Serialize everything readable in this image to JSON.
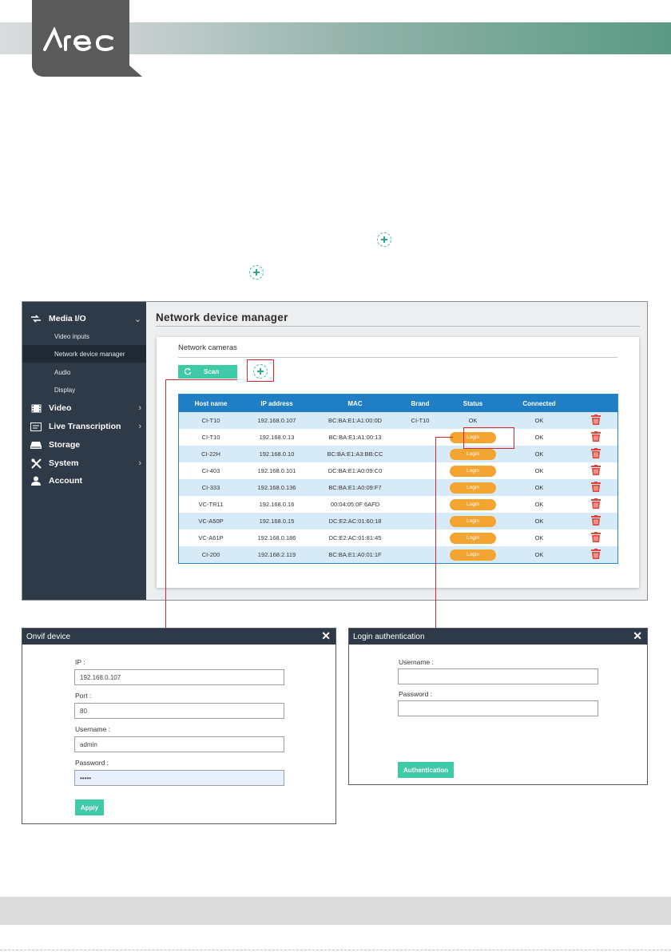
{
  "brand": {
    "logo_text": "Arec"
  },
  "sidebar": {
    "items": [
      {
        "label": "Media I/O",
        "icon": "media-io-icon",
        "chevron": "down"
      },
      {
        "label": "Video",
        "icon": "film-icon",
        "chevron": "right"
      },
      {
        "label": "Live Transcription",
        "icon": "caption-icon",
        "chevron": "right"
      },
      {
        "label": "Storage",
        "icon": "storage-icon",
        "chevron": ""
      },
      {
        "label": "System",
        "icon": "tools-icon",
        "chevron": "right"
      },
      {
        "label": "Account",
        "icon": "user-icon",
        "chevron": ""
      }
    ],
    "subitems": [
      {
        "label": "Video inputs",
        "active": false
      },
      {
        "label": "Network device manager",
        "active": true
      },
      {
        "label": "Audio",
        "active": false
      },
      {
        "label": "Display",
        "active": false
      }
    ]
  },
  "page": {
    "title": "Network device manager",
    "section_title": "Network cameras",
    "scan_label": "Scan"
  },
  "table": {
    "headers": [
      "Host name",
      "IP address",
      "MAC",
      "Brand",
      "Status",
      "Connected",
      ""
    ],
    "rows": [
      {
        "host": "CI-T10",
        "ip": "192.168.0.107",
        "mac": "BC:BA:E1:A1:00:0D",
        "brand": "CI-T10",
        "status": "OK",
        "connected": "OK"
      },
      {
        "host": "CI-T10",
        "ip": "192.168.0.13",
        "mac": "BC:BA:E1:A1:00:13",
        "brand": "",
        "status": "Login",
        "connected": "OK"
      },
      {
        "host": "CI-22H",
        "ip": "192.168.0.10",
        "mac": "BC:BA:E1:A3:BB:CC",
        "brand": "",
        "status": "Login",
        "connected": "OK"
      },
      {
        "host": "CI-403",
        "ip": "192.168.0.101",
        "mac": "DC:BA:E1:A0:09:C0",
        "brand": "",
        "status": "Login",
        "connected": "OK"
      },
      {
        "host": "CI-333",
        "ip": "192.168.0.136",
        "mac": "BC:BA:E1:A0:09:F7",
        "brand": "",
        "status": "Login",
        "connected": "OK"
      },
      {
        "host": "VC-TR11",
        "ip": "192.168.0.16",
        "mac": "00:04:05:0F:6AFD",
        "brand": "",
        "status": "Login",
        "connected": "OK"
      },
      {
        "host": "VC-A50P",
        "ip": "192.168.0.15",
        "mac": "DC:E2:AC:01:60:18",
        "brand": "",
        "status": "Login",
        "connected": "OK"
      },
      {
        "host": "VC-A61P",
        "ip": "192.168.0.186",
        "mac": "DC:E2:AC:01:81:45",
        "brand": "",
        "status": "Login",
        "connected": "OK"
      },
      {
        "host": "CI-200",
        "ip": "192.168.2.119",
        "mac": "BC:BA:E1:A0:01:1F",
        "brand": "",
        "status": "Login",
        "connected": "OK"
      }
    ]
  },
  "onvif_dialog": {
    "title": "Onvif device",
    "close": "✕",
    "ip_label": "IP :",
    "ip_value": "192.168.0.107",
    "port_label": "Port :",
    "port_value": "80",
    "username_label": "Username :",
    "username_value": "admin",
    "password_label": "Password :",
    "password_value": "•••••",
    "apply_label": "Apply"
  },
  "login_dialog": {
    "title": "Login authentication",
    "close": "✕",
    "username_label": "Username :",
    "username_value": "",
    "password_label": "Password :",
    "password_value": "",
    "auth_label": "Authentication"
  },
  "colors": {
    "accent": "#3ec9a7",
    "table_header": "#1f7ec4",
    "login_button": "#f3a431",
    "delete_icon": "#e0453b",
    "sidebar": "#2e3a48",
    "highlight": "#d9262c"
  }
}
